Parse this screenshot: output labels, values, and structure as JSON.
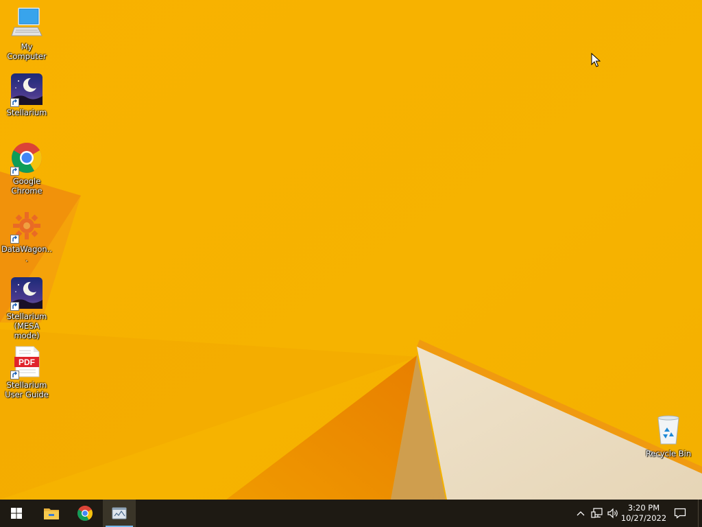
{
  "desktop": {
    "icons": [
      {
        "label": "My Computer",
        "icon": "computer-icon"
      },
      {
        "label": "Stellarium",
        "icon": "stellarium-icon"
      },
      {
        "label": "Google Chrome",
        "icon": "chrome-icon"
      },
      {
        "label": "DataWagon...",
        "icon": "datawagon-icon"
      },
      {
        "label": "Stellarium (MESA mode)",
        "icon": "stellarium-icon"
      },
      {
        "label": "Stellarium User Guide",
        "icon": "pdf-icon",
        "badge": "PDF"
      },
      {
        "label": "Recycle Bin",
        "icon": "recycle-bin-icon"
      }
    ]
  },
  "taskbar": {
    "start_icon": "windows-start-icon",
    "pinned": [
      {
        "name": "file-explorer",
        "icon": "folder-icon"
      },
      {
        "name": "google-chrome",
        "icon": "chrome-icon"
      },
      {
        "name": "stellarium-app",
        "icon": "app-window-icon",
        "active": true
      }
    ],
    "tray": {
      "icons": [
        "chevron-up-icon",
        "network-icon",
        "volume-icon"
      ],
      "time": "3:20 PM",
      "date": "10/27/2022",
      "notification_icon": "action-center-icon"
    }
  },
  "colors": {
    "wallpaper": "#f7b500",
    "taskbar": "#1e1a13",
    "active_indicator": "#76b9ed"
  }
}
